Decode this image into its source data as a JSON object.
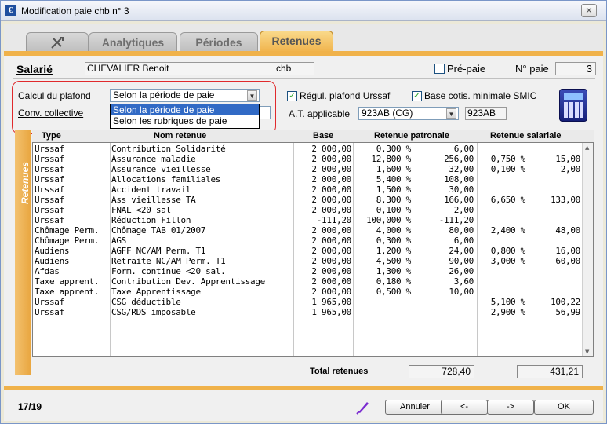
{
  "window": {
    "title": "Modification paie chb n° 3",
    "close_label": "✕"
  },
  "tabs": [
    {
      "label": ""
    },
    {
      "label": "Analytiques"
    },
    {
      "label": "Périodes"
    },
    {
      "label": "Retenues"
    }
  ],
  "header": {
    "salarie_label": "Salarié",
    "salarie_name": "CHEVALIER Benoit",
    "salarie_code": "chb",
    "prepaie_label": "Pré-paie",
    "prepaie_checked": false,
    "npaie_label": "N° paie",
    "npaie_value": "3"
  },
  "plafond": {
    "calcul_label": "Calcul du plafond",
    "calcul_value": "Selon la période de paie",
    "options": [
      "Selon la période de paie",
      "Selon les rubriques de paie"
    ],
    "conv_label": "Conv. collective"
  },
  "options": {
    "regul_label": "Régul. plafond Urssaf",
    "regul_checked": true,
    "base_label": "Base cotis. minimale SMIC",
    "base_checked": true,
    "at_label": "A.T. applicable",
    "at_value": "923AB (CG)",
    "at_code": "923AB"
  },
  "sidebar_label": "Retenues",
  "columns": {
    "type": "Type",
    "nom": "Nom retenue",
    "base": "Base",
    "patronale": "Retenue patronale",
    "salariale": "Retenue salariale"
  },
  "rows": [
    {
      "type": "Urssaf",
      "nom": "Contribution Solidarité",
      "base": "2 000,00",
      "pat_taux": "0,300 %",
      "pat_montant": "6,00",
      "sal_taux": "",
      "sal_montant": ""
    },
    {
      "type": "Urssaf",
      "nom": "Assurance maladie",
      "base": "2 000,00",
      "pat_taux": "12,800 %",
      "pat_montant": "256,00",
      "sal_taux": "0,750 %",
      "sal_montant": "15,00"
    },
    {
      "type": "Urssaf",
      "nom": "Assurance vieillesse",
      "base": "2 000,00",
      "pat_taux": "1,600 %",
      "pat_montant": "32,00",
      "sal_taux": "0,100 %",
      "sal_montant": "2,00"
    },
    {
      "type": "Urssaf",
      "nom": "Allocations familiales",
      "base": "2 000,00",
      "pat_taux": "5,400 %",
      "pat_montant": "108,00",
      "sal_taux": "",
      "sal_montant": ""
    },
    {
      "type": "Urssaf",
      "nom": "Accident travail",
      "base": "2 000,00",
      "pat_taux": "1,500 %",
      "pat_montant": "30,00",
      "sal_taux": "",
      "sal_montant": ""
    },
    {
      "type": "Urssaf",
      "nom": "Ass vieillesse TA",
      "base": "2 000,00",
      "pat_taux": "8,300 %",
      "pat_montant": "166,00",
      "sal_taux": "6,650 %",
      "sal_montant": "133,00"
    },
    {
      "type": "Urssaf",
      "nom": "FNAL <20 sal",
      "base": "2 000,00",
      "pat_taux": "0,100 %",
      "pat_montant": "2,00",
      "sal_taux": "",
      "sal_montant": ""
    },
    {
      "type": "Urssaf",
      "nom": "Réduction Fillon",
      "base": "-111,20",
      "pat_taux": "100,000 %",
      "pat_montant": "-111,20",
      "sal_taux": "",
      "sal_montant": ""
    },
    {
      "type": "Chômage Perm.",
      "nom": "Chômage TAB 01/2007",
      "base": "2 000,00",
      "pat_taux": "4,000 %",
      "pat_montant": "80,00",
      "sal_taux": "2,400 %",
      "sal_montant": "48,00"
    },
    {
      "type": "Chômage Perm.",
      "nom": "AGS",
      "base": "2 000,00",
      "pat_taux": "0,300 %",
      "pat_montant": "6,00",
      "sal_taux": "",
      "sal_montant": ""
    },
    {
      "type": "Audiens",
      "nom": "AGFF NC/AM Perm. T1",
      "base": "2 000,00",
      "pat_taux": "1,200 %",
      "pat_montant": "24,00",
      "sal_taux": "0,800 %",
      "sal_montant": "16,00"
    },
    {
      "type": "Audiens",
      "nom": "Retraite NC/AM Perm. T1",
      "base": "2 000,00",
      "pat_taux": "4,500 %",
      "pat_montant": "90,00",
      "sal_taux": "3,000 %",
      "sal_montant": "60,00"
    },
    {
      "type": "Afdas",
      "nom": "Form. continue <20 sal.",
      "base": "2 000,00",
      "pat_taux": "1,300 %",
      "pat_montant": "26,00",
      "sal_taux": "",
      "sal_montant": ""
    },
    {
      "type": "Taxe apprent.",
      "nom": "Contribution Dev. Apprentissage",
      "base": "2 000,00",
      "pat_taux": "0,180 %",
      "pat_montant": "3,60",
      "sal_taux": "",
      "sal_montant": ""
    },
    {
      "type": "Taxe apprent.",
      "nom": "Taxe Apprentissage",
      "base": "2 000,00",
      "pat_taux": "0,500 %",
      "pat_montant": "10,00",
      "sal_taux": "",
      "sal_montant": ""
    },
    {
      "type": "Urssaf",
      "nom": "CSG déductible",
      "base": "1 965,00",
      "pat_taux": "",
      "pat_montant": "",
      "sal_taux": "5,100 %",
      "sal_montant": "100,22"
    },
    {
      "type": "Urssaf",
      "nom": "CSG/RDS imposable",
      "base": "1 965,00",
      "pat_taux": "",
      "pat_montant": "",
      "sal_taux": "2,900 %",
      "sal_montant": "56,99"
    }
  ],
  "totals": {
    "label": "Total retenues",
    "patronale": "728,40",
    "salariale": "431,21"
  },
  "footer": {
    "page": "17/19",
    "annuler": "Annuler",
    "prev": "<-",
    "next": "->",
    "ok": "OK"
  },
  "colors": {
    "accent": "#f0b24a",
    "highlight": "#e0292c",
    "selection": "#316ac5"
  },
  "icons": [
    "app-icon",
    "close-icon",
    "tools-icon",
    "calculator-icon",
    "pen-icon",
    "chevron-down-icon",
    "check-icon"
  ]
}
